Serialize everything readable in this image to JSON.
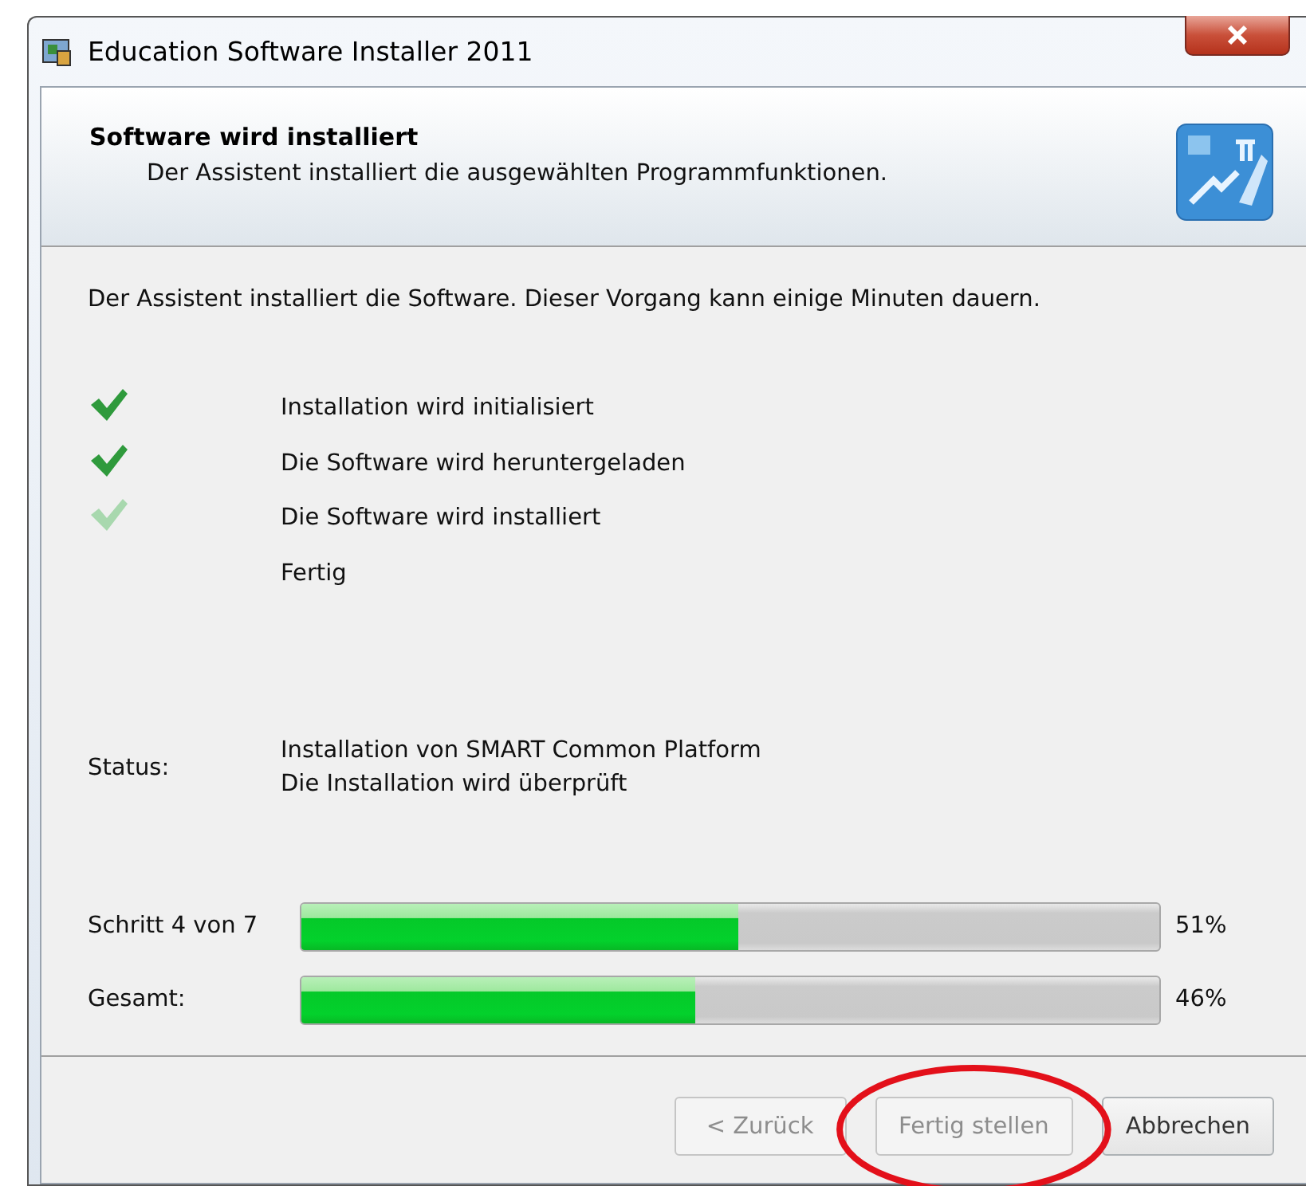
{
  "window": {
    "title": "Education Software Installer 2011"
  },
  "header": {
    "title": "Software wird installiert",
    "subtitle": "Der Assistent installiert die ausgewählten Programmfunktionen."
  },
  "intro": "Der Assistent installiert die Software. Dieser Vorgang kann einige Minuten dauern.",
  "steps": [
    {
      "label": "Installation wird initialisiert",
      "kind": "done"
    },
    {
      "label": "Die Software wird heruntergeladen",
      "kind": "done"
    },
    {
      "label": "Die Software wird installiert",
      "kind": "active"
    },
    {
      "label": "Fertig",
      "kind": "pending"
    }
  ],
  "status": {
    "label": "Status:",
    "lines": [
      "Installation von SMART Common Platform",
      "Die Installation wird überprüft"
    ]
  },
  "progress": [
    {
      "label": "Schritt 4 von 7",
      "level": 0.51,
      "reading": "51%"
    },
    {
      "label": "Gesamt:",
      "level": 0.46,
      "reading": "46%"
    }
  ],
  "buttons": [
    {
      "label": "< Zurück",
      "disabled": true,
      "circled": false
    },
    {
      "label": "Fertig stellen",
      "disabled": true,
      "circled": true
    },
    {
      "label": "Abbrechen",
      "disabled": false,
      "circled": false
    }
  ]
}
